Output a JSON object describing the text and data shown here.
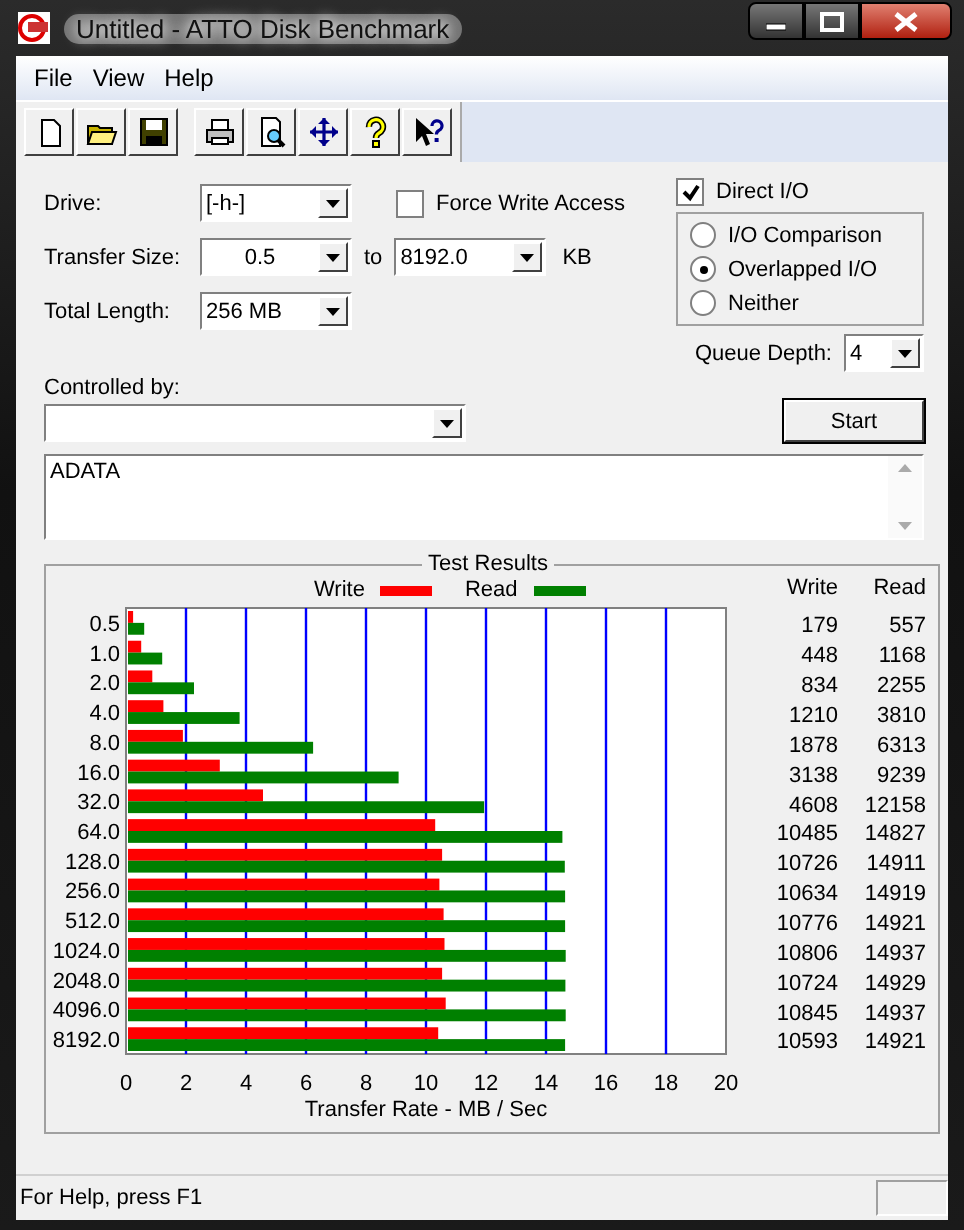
{
  "window": {
    "title": "Untitled - ATTO Disk Benchmark"
  },
  "menu": [
    "File",
    "View",
    "Help"
  ],
  "settings": {
    "drive": {
      "label": "Drive:",
      "value": "[-h-]"
    },
    "force_write_access": {
      "label": "Force Write Access",
      "checked": false
    },
    "transfer_size": {
      "label": "Transfer Size:",
      "from": "0.5",
      "to_label": "to",
      "to": "8192.0",
      "unit": "KB"
    },
    "total_length": {
      "label": "Total Length:",
      "value": "256 MB"
    },
    "direct_io": {
      "label": "Direct I/O",
      "checked": true
    },
    "io_modes": [
      {
        "label": "I/O Comparison",
        "selected": false
      },
      {
        "label": "Overlapped I/O",
        "selected": true
      },
      {
        "label": "Neither",
        "selected": false
      }
    ],
    "queue_depth": {
      "label": "Queue Depth:",
      "value": "4"
    },
    "controlled_by": {
      "label": "Controlled by:"
    }
  },
  "start_button": "Start",
  "description": "ADATA",
  "test_results": {
    "title": "Test Results",
    "columns": [
      "Write",
      "Read"
    ],
    "rows": [
      {
        "write": "179",
        "read": "557"
      },
      {
        "write": "448",
        "read": "1168"
      },
      {
        "write": "834",
        "read": "2255"
      },
      {
        "write": "1210",
        "read": "3810"
      },
      {
        "write": "1878",
        "read": "6313"
      },
      {
        "write": "3138",
        "read": "9239"
      },
      {
        "write": "4608",
        "read": "12158"
      },
      {
        "write": "10485",
        "read": "14827"
      },
      {
        "write": "10726",
        "read": "14911"
      },
      {
        "write": "10634",
        "read": "14919"
      },
      {
        "write": "10776",
        "read": "14921"
      },
      {
        "write": "10806",
        "read": "14937"
      },
      {
        "write": "10724",
        "read": "14929"
      },
      {
        "write": "10845",
        "read": "14937"
      },
      {
        "write": "10593",
        "read": "14921"
      }
    ],
    "chart_data": {
      "type": "bar",
      "orientation": "horizontal",
      "xlabel": "Transfer Rate - MB / Sec",
      "categories": [
        "0.5",
        "1.0",
        "2.0",
        "4.0",
        "8.0",
        "16.0",
        "32.0",
        "64.0",
        "128.0",
        "256.0",
        "512.0",
        "1024.0",
        "2048.0",
        "4096.0",
        "8192.0"
      ],
      "series": [
        {
          "name": "Write",
          "color": "#ff0000",
          "values": [
            0.17,
            0.44,
            0.81,
            1.18,
            1.83,
            3.06,
            4.5,
            10.24,
            10.47,
            10.38,
            10.52,
            10.55,
            10.47,
            10.59,
            10.34
          ]
        },
        {
          "name": "Read",
          "color": "#008000",
          "values": [
            0.54,
            1.14,
            2.2,
            3.72,
            6.17,
            9.02,
            11.87,
            14.48,
            14.56,
            14.57,
            14.57,
            14.59,
            14.58,
            14.59,
            14.57
          ]
        }
      ],
      "grid": true,
      "xlim": [
        0,
        20
      ],
      "xticks": [
        0,
        2,
        4,
        6,
        8,
        10,
        12,
        14,
        16,
        18,
        20
      ]
    }
  },
  "status_bar": "For Help, press F1"
}
